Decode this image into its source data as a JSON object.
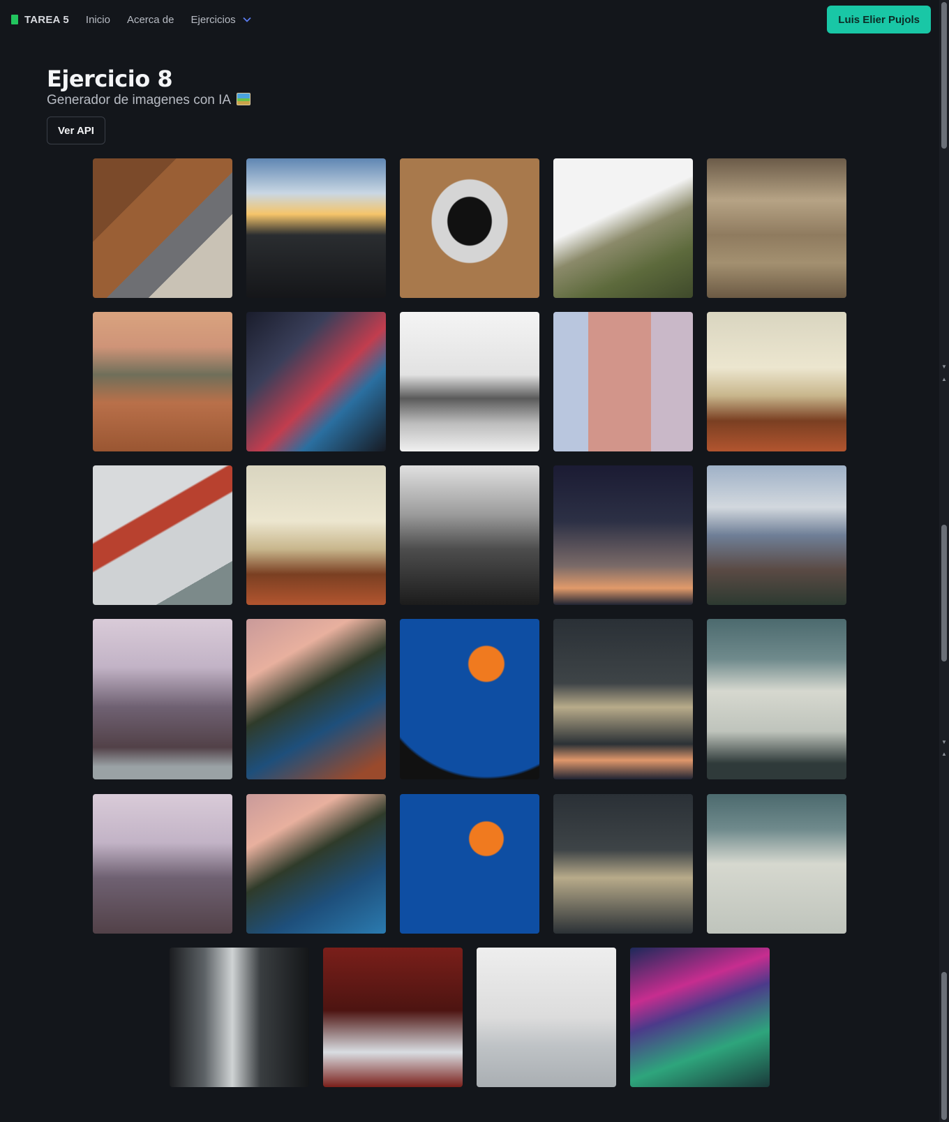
{
  "nav": {
    "brand": "TAREA 5",
    "links": [
      "Inicio",
      "Acerca de"
    ],
    "dropdown_label": "Ejercicios",
    "user_button": "Luis Elier Pujols"
  },
  "page": {
    "title": "Ejercicio 8",
    "subtitle": "Generador de imagenes con IA",
    "api_button": "Ver API"
  },
  "colors": {
    "background": "#13161b",
    "accent": "#19c7a6",
    "brand_icon": "#22c55e",
    "dropdown_chevron": "#5b7cf0"
  },
  "gallery": {
    "images": [
      "laptop-desk-photo",
      "sunset-jump-photo",
      "laptop-coffee-photo",
      "foggy-forest-slope-photo",
      "sepia-hills-trees-photo",
      "sunset-sea-waves-photo",
      "city-night-lights-photo",
      "cloudy-mountain-peaks-photo",
      "leaning-tower-photo",
      "open-book-photo",
      "golden-gate-bridge-photo",
      "open-book-photo",
      "foggy-skyline-photo",
      "dusk-horizon-photo",
      "matterhorn-photo",
      "pink-mountains-photo",
      "coastal-road-photo",
      "orange-jellyfish-photo",
      "stone-wall-light-photo",
      "map-desk-photo",
      "pink-mountains-photo",
      "coastal-road-photo",
      "orange-jellyfish-photo",
      "stone-wall-light-photo",
      "map-desk-photo",
      "misty-forest-photo",
      "sailboat-bow-photo",
      "calm-sea-fog-photo",
      "space-station-aurora-photo"
    ]
  }
}
